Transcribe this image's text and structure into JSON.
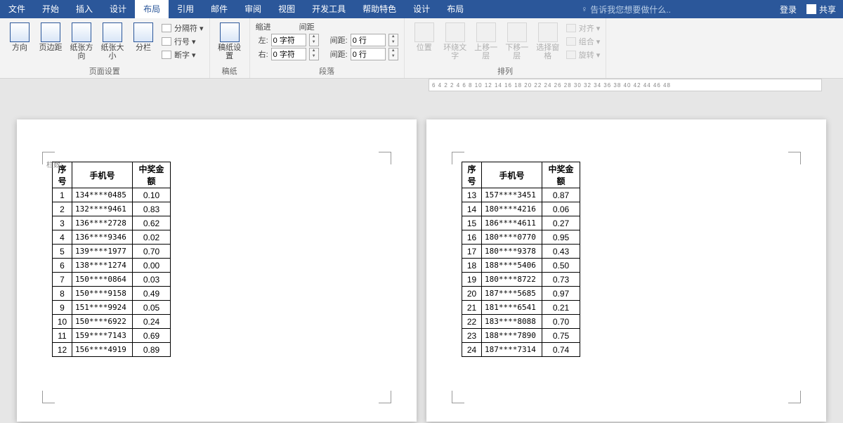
{
  "menubar": {
    "items": [
      "文件",
      "开始",
      "插入",
      "设计",
      "布局",
      "引用",
      "邮件",
      "审阅",
      "视图",
      "开发工具",
      "帮助特色",
      "设计",
      "布局"
    ],
    "active_index": 4,
    "search_placeholder": "告诉我您想要做什么..",
    "login": "登录",
    "share": "共享"
  },
  "ribbon": {
    "page_setup": {
      "label": "页面设置",
      "btns": [
        "方向",
        "页边距",
        "纸张方向",
        "纸张大小",
        "分栏"
      ],
      "side": [
        "分隔符",
        "行号",
        "断字"
      ]
    },
    "manuscript": {
      "label": "稿纸",
      "btn": "稿纸设置"
    },
    "paragraph": {
      "label": "段落",
      "indent_label": "缩进",
      "spacing_label": "间距",
      "left_label": "左:",
      "left_val": "0 字符",
      "right_label": "右:",
      "right_val": "0 字符",
      "before_label": "间距:",
      "before_val": "0 行",
      "after_label": "间距:",
      "after_val": "0 行"
    },
    "arrange": {
      "label": "排列",
      "btns": [
        "位置",
        "环绕文字",
        "上移一层",
        "下移一层",
        "选择窗格"
      ],
      "side": [
        "对齐",
        "组合",
        "旋转"
      ]
    }
  },
  "ruler_text": "6  4  2  2  4  6  8  10 12 14 16 18 20 22 24 26 28 30 32 34 36 38 40 42 44 46 48",
  "page_label": "栏数:",
  "table_headers": [
    "序号",
    "手机号",
    "中奖金额"
  ],
  "table1": [
    [
      "1",
      "134****0485",
      "0.10"
    ],
    [
      "2",
      "132****9461",
      "0.83"
    ],
    [
      "3",
      "136****2728",
      "0.62"
    ],
    [
      "4",
      "136****9346",
      "0.02"
    ],
    [
      "5",
      "139****1977",
      "0.70"
    ],
    [
      "6",
      "138****1274",
      "0.00"
    ],
    [
      "7",
      "150****0864",
      "0.03"
    ],
    [
      "8",
      "150****9158",
      "0.49"
    ],
    [
      "9",
      "151****9924",
      "0.05"
    ],
    [
      "10",
      "150****6922",
      "0.24"
    ],
    [
      "11",
      "159****7143",
      "0.69"
    ],
    [
      "12",
      "156****4919",
      "0.89"
    ]
  ],
  "table2": [
    [
      "13",
      "157****3451",
      "0.87"
    ],
    [
      "14",
      "180****4216",
      "0.06"
    ],
    [
      "15",
      "186****4611",
      "0.27"
    ],
    [
      "16",
      "180****0770",
      "0.95"
    ],
    [
      "17",
      "180****9378",
      "0.43"
    ],
    [
      "18",
      "188****5406",
      "0.50"
    ],
    [
      "19",
      "180****8722",
      "0.73"
    ],
    [
      "20",
      "187****5685",
      "0.97"
    ],
    [
      "21",
      "181****6541",
      "0.21"
    ],
    [
      "22",
      "183****8088",
      "0.70"
    ],
    [
      "23",
      "188****7890",
      "0.75"
    ],
    [
      "24",
      "187****7314",
      "0.74"
    ]
  ]
}
